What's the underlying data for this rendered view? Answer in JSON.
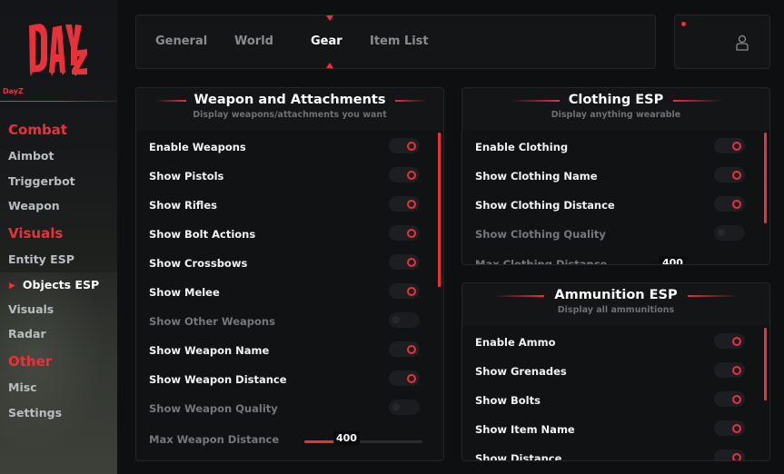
{
  "sidebar": {
    "game_name": "DayZ",
    "sections": [
      {
        "label": "Combat",
        "items": [
          "Aimbot",
          "Triggerbot",
          "Weapon"
        ]
      },
      {
        "label": "Visuals",
        "items": [
          "Entity ESP",
          "Objects ESP",
          "Visuals",
          "Radar"
        ]
      },
      {
        "label": "Other",
        "items": [
          "Misc",
          "Settings"
        ]
      }
    ],
    "active_item": "Objects ESP"
  },
  "tabs": [
    "General",
    "World",
    "Gear",
    "Item List"
  ],
  "active_tab": "Gear",
  "accent_color": "#e8323a",
  "weapon_panel": {
    "title": "Weapon and Attachments",
    "subtitle": "Display weapons/attachments you want",
    "options": [
      {
        "label": "Enable Weapons",
        "enabled": true
      },
      {
        "label": "Show Pistols",
        "enabled": true
      },
      {
        "label": "Show Rifles",
        "enabled": true
      },
      {
        "label": "Show Bolt Actions",
        "enabled": true
      },
      {
        "label": "Show Crossbows",
        "enabled": true
      },
      {
        "label": "Show Melee",
        "enabled": true
      },
      {
        "label": "Show Other Weapons",
        "enabled": false
      },
      {
        "label": "Show Weapon Name",
        "enabled": true
      },
      {
        "label": "Show Weapon Distance",
        "enabled": true
      },
      {
        "label": "Show Weapon Quality",
        "enabled": false
      }
    ],
    "slider": {
      "label": "Max Weapon Distance",
      "value": "400"
    }
  },
  "clothing_panel": {
    "title": "Clothing ESP",
    "subtitle": "Display anything wearable",
    "options": [
      {
        "label": "Enable Clothing",
        "enabled": true
      },
      {
        "label": "Show Clothing Name",
        "enabled": true
      },
      {
        "label": "Show Clothing Distance",
        "enabled": true
      },
      {
        "label": "Show Clothing Quality",
        "enabled": false
      }
    ],
    "slider": {
      "label": "Max Clothing Distance",
      "value": "400"
    }
  },
  "ammo_panel": {
    "title": "Ammunition ESP",
    "subtitle": "Display all ammunitions",
    "options": [
      {
        "label": "Enable Ammo",
        "enabled": true
      },
      {
        "label": "Show Grenades",
        "enabled": true
      },
      {
        "label": "Show Bolts",
        "enabled": true
      },
      {
        "label": "Show Item Name",
        "enabled": true
      },
      {
        "label": "Show Distance",
        "enabled": true
      }
    ]
  }
}
